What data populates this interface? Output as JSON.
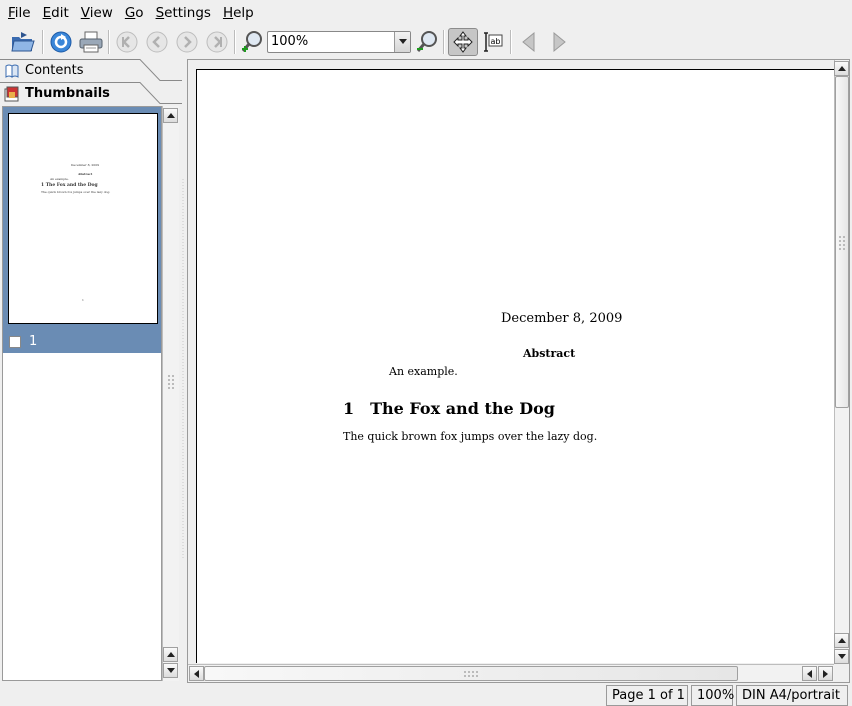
{
  "menu": [
    {
      "label": "File",
      "mnemonic": "F",
      "rest": "ile"
    },
    {
      "label": "Edit",
      "mnemonic": "E",
      "rest": "dit"
    },
    {
      "label": "View",
      "mnemonic": "V",
      "rest": "iew"
    },
    {
      "label": "Go",
      "mnemonic": "G",
      "rest": "o"
    },
    {
      "label": "Settings",
      "mnemonic": "S",
      "rest": "ettings"
    },
    {
      "label": "Help",
      "mnemonic": "H",
      "rest": "elp"
    }
  ],
  "toolbar": {
    "zoom_value": "100%",
    "icons": [
      "open-folder-icon",
      "reload-icon",
      "print-icon",
      "first-page-icon",
      "previous-page-icon",
      "next-page-icon",
      "last-page-icon",
      "zoom-in-icon",
      "zoom-out-icon",
      "browse-tool-icon",
      "text-select-icon",
      "back-icon",
      "forward-icon"
    ]
  },
  "sidebar": {
    "tabs": [
      "Contents",
      "Thumbnails"
    ],
    "thumbnail": {
      "page_label": "1",
      "mini_text": {
        "date": "December 8, 2009",
        "abstract": "Abstract",
        "abstract_text": "An example.",
        "heading": "1   The Fox and the Dog",
        "body": "The quick brown fox jumps over the lazy dog.",
        "page_number": "1"
      }
    }
  },
  "document": {
    "date": "December 8, 2009",
    "abstract_heading": "Abstract",
    "abstract_text": "An example.",
    "section_heading": "1 The Fox and the Dog",
    "body_text": "The quick brown fox jumps over the lazy dog."
  },
  "statusbar": {
    "page": "Page 1 of 1",
    "zoom": "100%",
    "paper": "DIN A4/portrait"
  },
  "colors": {
    "selection": "#6a8cb4",
    "window_bg": "#efefef"
  }
}
